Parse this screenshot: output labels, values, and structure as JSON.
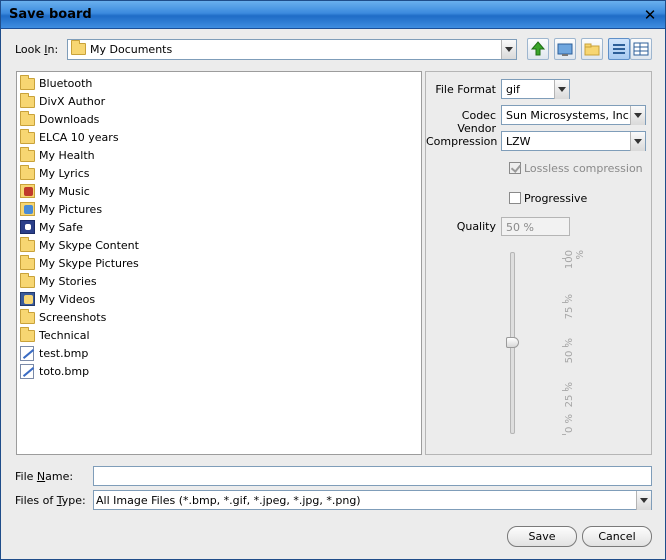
{
  "window": {
    "title": "Save board"
  },
  "look_in": {
    "label_pre": "Look ",
    "label_mnemonic": "I",
    "label_post": "n:",
    "value": "My Documents"
  },
  "toolbar": {
    "buttons": [
      "up-one-level-icon",
      "desktop-icon",
      "new-folder-icon",
      "list-view-icon",
      "details-view-icon"
    ]
  },
  "files": [
    {
      "name": "Bluetooth",
      "icon": "folder-icon"
    },
    {
      "name": "DivX Author",
      "icon": "folder-icon"
    },
    {
      "name": "Downloads",
      "icon": "folder-icon"
    },
    {
      "name": "ELCA 10 years",
      "icon": "folder-icon"
    },
    {
      "name": "My Health",
      "icon": "folder-icon"
    },
    {
      "name": "My Lyrics",
      "icon": "folder-icon"
    },
    {
      "name": "My Music",
      "icon": "music-folder-icon"
    },
    {
      "name": "My Pictures",
      "icon": "pictures-folder-icon"
    },
    {
      "name": "My Safe",
      "icon": "safe-icon"
    },
    {
      "name": "My Skype Content",
      "icon": "folder-icon"
    },
    {
      "name": "My Skype Pictures",
      "icon": "folder-icon"
    },
    {
      "name": "My Stories",
      "icon": "folder-icon"
    },
    {
      "name": "My Videos",
      "icon": "videos-folder-icon"
    },
    {
      "name": "Screenshots",
      "icon": "folder-icon"
    },
    {
      "name": "Technical",
      "icon": "folder-icon"
    },
    {
      "name": "test.bmp",
      "icon": "bmp-file-icon"
    },
    {
      "name": "toto.bmp",
      "icon": "bmp-file-icon"
    }
  ],
  "options": {
    "file_format_label": "File Format",
    "file_format_value": "gif",
    "codec_vendor_label": "Codec Vendor",
    "codec_vendor_value": "Sun Microsystems, Inc.",
    "compression_label": "Compression",
    "compression_value": "LZW",
    "lossless_label": "Lossless compression",
    "lossless_checked": true,
    "progressive_label": "Progressive",
    "progressive_checked": false,
    "quality_label": "Quality",
    "quality_value": "50 %",
    "quality_level": 50,
    "slider_ticks": [
      "100 %",
      "75 %",
      "50 %",
      "25 %",
      "0 %"
    ]
  },
  "file_name": {
    "label_pre": "File ",
    "label_mnemonic": "N",
    "label_post": "ame:",
    "value": ""
  },
  "file_type": {
    "label_pre": "Files of ",
    "label_mnemonic": "T",
    "label_post": "ype:",
    "value": "All Image Files (*.bmp, *.gif, *.jpeg, *.jpg, *.png)"
  },
  "buttons": {
    "save": "Save",
    "cancel": "Cancel"
  },
  "colors": {
    "title_bar": "#3b8ade",
    "accent": "#7f9db9",
    "folder": "#f7d672"
  }
}
